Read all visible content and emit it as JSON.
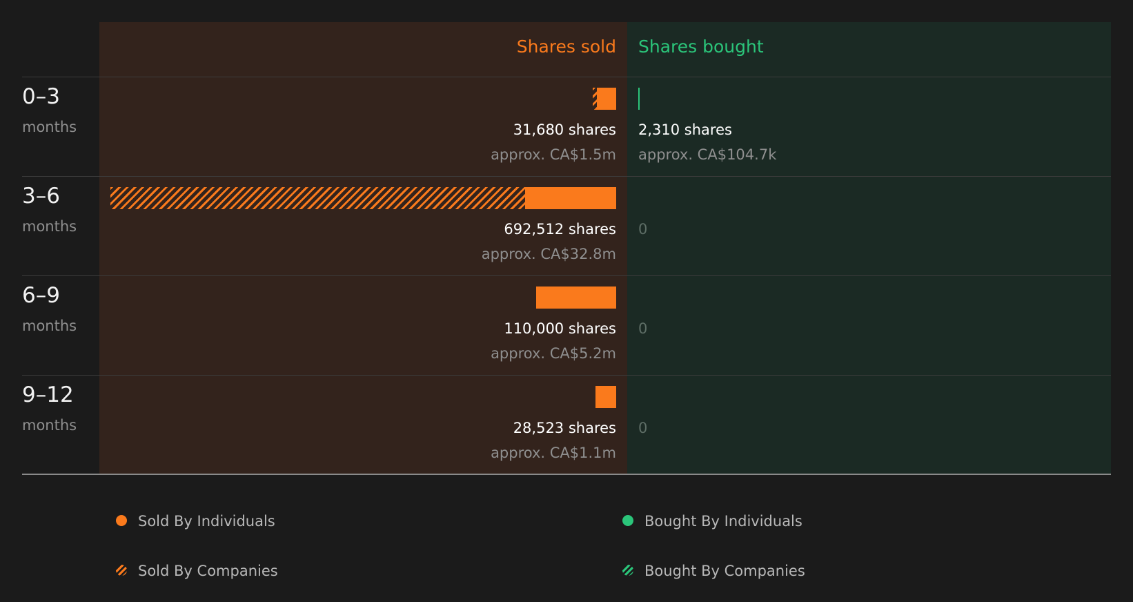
{
  "chart_data": {
    "type": "bar",
    "headers": {
      "sold": "Shares sold",
      "bought": "Shares bought"
    },
    "rows": [
      {
        "period": "0–3",
        "unit": "months",
        "sold": {
          "individuals": 26000,
          "companies": 5680,
          "shares_label": "31,680 shares",
          "value_label": "approx. CA$1.5m"
        },
        "bought": {
          "individuals": 2310,
          "companies": 0,
          "shares_label": "2,310 shares",
          "value_label": "approx. CA$104.7k"
        }
      },
      {
        "period": "3–6",
        "unit": "months",
        "sold": {
          "individuals": 125000,
          "companies": 567512,
          "shares_label": "692,512 shares",
          "value_label": "approx. CA$32.8m"
        },
        "bought": {
          "individuals": 0,
          "companies": 0,
          "shares_label": "0",
          "value_label": ""
        }
      },
      {
        "period": "6–9",
        "unit": "months",
        "sold": {
          "individuals": 110000,
          "companies": 0,
          "shares_label": "110,000 shares",
          "value_label": "approx. CA$5.2m"
        },
        "bought": {
          "individuals": 0,
          "companies": 0,
          "shares_label": "0",
          "value_label": ""
        }
      },
      {
        "period": "9–12",
        "unit": "months",
        "sold": {
          "individuals": 28523,
          "companies": 0,
          "shares_label": "28,523 shares",
          "value_label": "approx. CA$1.1m"
        },
        "bought": {
          "individuals": 0,
          "companies": 0,
          "shares_label": "0",
          "value_label": ""
        }
      }
    ],
    "legend": [
      {
        "label": "Sold By Individuals",
        "kind": "sold-individuals"
      },
      {
        "label": "Bought By Individuals",
        "kind": "bought-individuals"
      },
      {
        "label": "Sold By Companies",
        "kind": "sold-companies"
      },
      {
        "label": "Bought By Companies",
        "kind": "bought-companies"
      }
    ],
    "colors": {
      "sold": "#fa7a1c",
      "bought": "#2bc57a"
    }
  }
}
